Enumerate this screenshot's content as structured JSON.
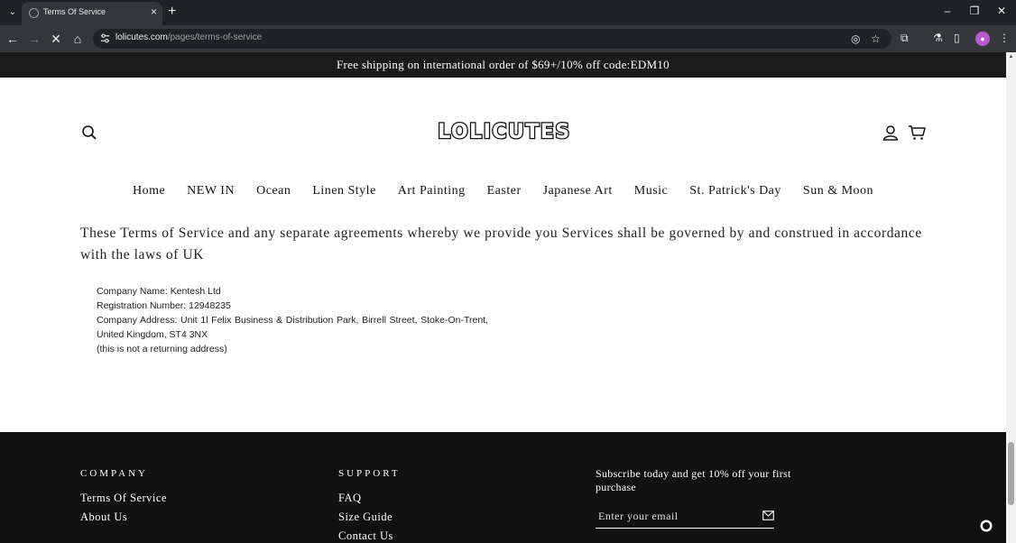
{
  "browser": {
    "tab_title": "Terms Of Service",
    "url_host": "lolicutes.com",
    "url_path": "/pages/terms-of-service"
  },
  "announcement": "Free shipping on international order of $69+/10% off code:EDM10",
  "header": {
    "logo": "LOLICUTES"
  },
  "nav": {
    "items": [
      "Home",
      "NEW IN",
      "Ocean",
      "Linen Style",
      "Art Painting",
      "Easter",
      "Japanese Art",
      "Music",
      "St. Patrick's Day",
      "Sun & Moon"
    ]
  },
  "content": {
    "paragraph": "These Terms of Service and any separate agreements whereby we provide you Services shall be governed by and construed in accordance with the laws of UK",
    "company_lines": [
      "Company Name: Kentesh Ltd",
      "Registration Number: 12948235",
      "Company Address: Unit 1l Felix Business & Distribution Park, Birrell Street, Stoke-On-Trent,",
      "United Kingdom, ST4 3NX",
      "(this is not a returning address)"
    ]
  },
  "footer": {
    "company_heading": "COMPANY",
    "company_links": [
      "Terms Of Service",
      "About Us"
    ],
    "support_heading": "SUPPORT",
    "support_links": [
      "FAQ",
      "Size Guide",
      "Contact Us"
    ],
    "subscribe_text": "Subscribe today and get 10% off your first purchase",
    "email_placeholder": "Enter your email"
  }
}
